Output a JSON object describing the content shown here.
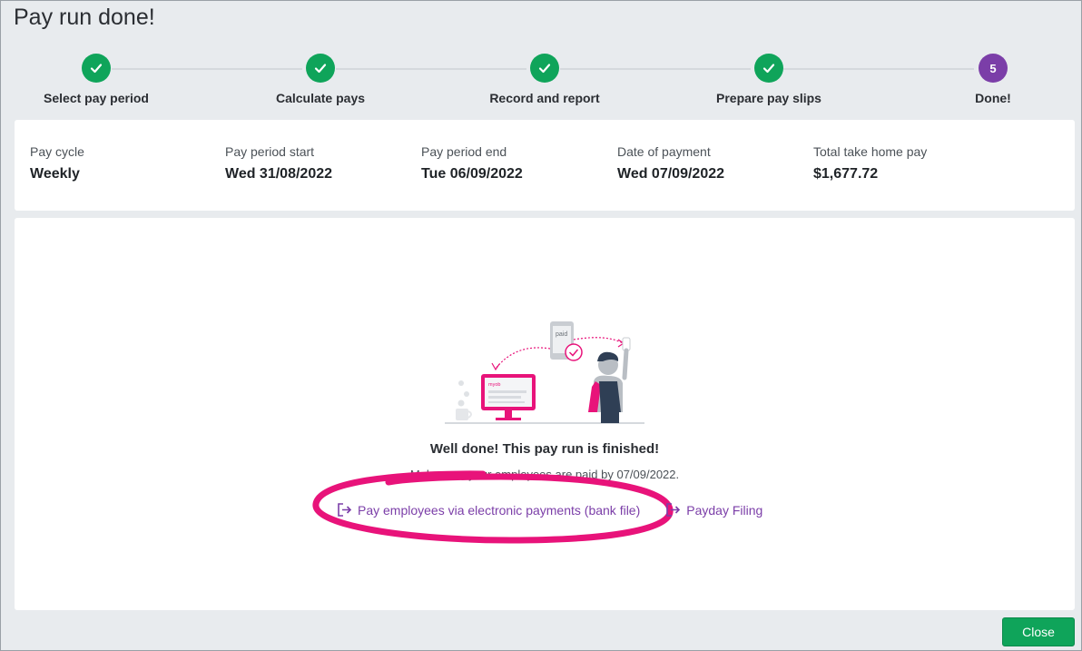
{
  "page": {
    "title": "Pay run done!"
  },
  "stepper": {
    "steps": [
      {
        "label": "Select pay period",
        "status": "done"
      },
      {
        "label": "Calculate pays",
        "status": "done"
      },
      {
        "label": "Record and report",
        "status": "done"
      },
      {
        "label": "Prepare pay slips",
        "status": "done"
      },
      {
        "label": "Done!",
        "status": "current",
        "number": "5"
      }
    ]
  },
  "summary": {
    "pay_cycle": {
      "label": "Pay cycle",
      "value": "Weekly"
    },
    "period_start": {
      "label": "Pay period start",
      "value": "Wed 31/08/2022"
    },
    "period_end": {
      "label": "Pay period end",
      "value": "Tue 06/09/2022"
    },
    "payment_date": {
      "label": "Date of payment",
      "value": "Wed 07/09/2022"
    },
    "take_home": {
      "label": "Total take home pay",
      "value": "$1,677.72"
    }
  },
  "illustration": {
    "phone_text": "paid",
    "screen_logo": "myob"
  },
  "completion": {
    "heading": "Well done! This pay run is finished!",
    "subtext": "Make sure your employees are paid by 07/09/2022."
  },
  "links": {
    "bank_file": "Pay employees via electronic payments (bank file)",
    "payday_filing": "Payday Filing"
  },
  "footer": {
    "close_label": "Close"
  },
  "colors": {
    "success_green": "#0fa45a",
    "current_purple": "#7b3ea8",
    "link_purple": "#7b3ea8",
    "highlight_pink": "#e8137a"
  }
}
